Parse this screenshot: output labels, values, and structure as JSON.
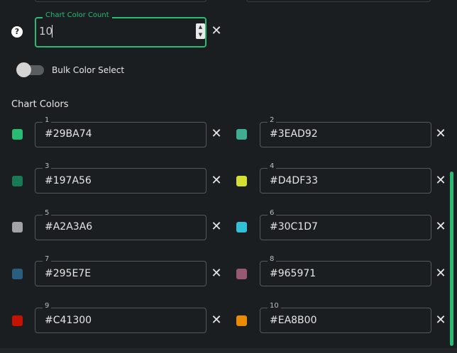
{
  "settings": {
    "chart_color_count": {
      "label": "Chart Color Count",
      "value": "10",
      "help_icon": "question-circle-icon",
      "clear_icon": "close-icon",
      "accent": "#29BA74"
    },
    "bulk_color_select": {
      "label": "Bulk Color Select",
      "enabled": false
    }
  },
  "chart_colors": {
    "title": "Chart Colors",
    "items": [
      {
        "index": "1",
        "hex": "#29BA74"
      },
      {
        "index": "2",
        "hex": "#3EAD92"
      },
      {
        "index": "3",
        "hex": "#197A56"
      },
      {
        "index": "4",
        "hex": "#D4DF33"
      },
      {
        "index": "5",
        "hex": "#A2A3A6"
      },
      {
        "index": "6",
        "hex": "#30C1D7"
      },
      {
        "index": "7",
        "hex": "#295E7E"
      },
      {
        "index": "8",
        "hex": "#965971"
      },
      {
        "index": "9",
        "hex": "#C41300"
      },
      {
        "index": "10",
        "hex": "#EA8B00"
      }
    ]
  }
}
